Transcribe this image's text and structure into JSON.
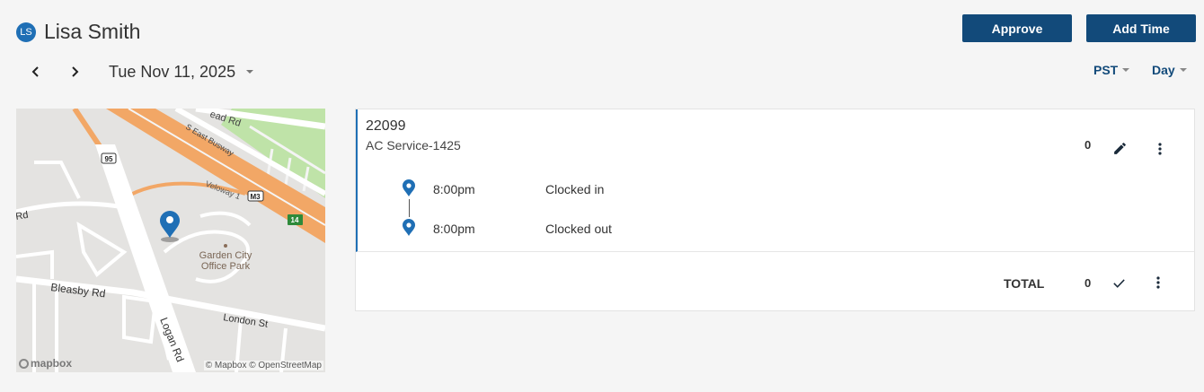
{
  "user": {
    "initials": "LS",
    "name": "Lisa Smith"
  },
  "actions": {
    "approve_label": "Approve",
    "add_time_label": "Add Time"
  },
  "date_nav": {
    "date": "Tue Nov 11, 2025"
  },
  "timezone": {
    "selected": "PST"
  },
  "view": {
    "selected": "Day"
  },
  "map": {
    "labels": {
      "road_top": "ead Rd",
      "busway": "S East Busway",
      "veloway": "Veloway 1",
      "shield_95": "95",
      "shield_m3": "M3",
      "shield_14": "14",
      "left_rd": "Rd",
      "poi_line1": "Garden City",
      "poi_line2": "Office Park",
      "bleasby": "Bleasby Rd",
      "london": "London St",
      "logan": "Logan Rd"
    },
    "logo": "mapbox",
    "credit": "© Mapbox © OpenStreetMap"
  },
  "job": {
    "id": "22099",
    "name": "AC Service-1425",
    "hours": "0",
    "entries": [
      {
        "time": "8:00pm",
        "status": "Clocked in"
      },
      {
        "time": "8:00pm",
        "status": "Clocked out"
      }
    ],
    "total_label": "TOTAL",
    "total_value": "0"
  },
  "colors": {
    "primary": "#124a7a",
    "accent": "#1f6fb5",
    "background": "#f5f5f5"
  }
}
